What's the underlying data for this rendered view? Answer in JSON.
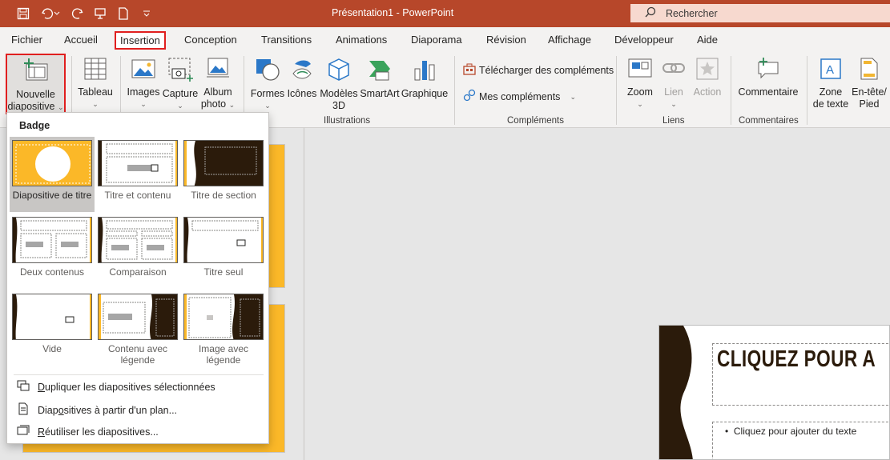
{
  "titlebar": {
    "title": "Présentation1  -  PowerPoint",
    "search_placeholder": "Rechercher"
  },
  "tabs": [
    "Fichier",
    "Accueil",
    "Insertion",
    "Conception",
    "Transitions",
    "Animations",
    "Diaporama",
    "Révision",
    "Affichage",
    "Développeur",
    "Aide"
  ],
  "ribbon": {
    "new_slide": [
      "Nouvelle",
      "diapositive"
    ],
    "table": "Tableau",
    "images": "Images",
    "capture": "Capture",
    "album": [
      "Album",
      "photo"
    ],
    "shapes": "Formes",
    "icons": "Icônes",
    "models3d": [
      "Modèles",
      "3D"
    ],
    "smartart": "SmartArt",
    "chart": "Graphique",
    "get_addins": "Télécharger des compléments",
    "my_addins": "Mes compléments",
    "zoom": "Zoom",
    "link": "Lien",
    "action": "Action",
    "comment": "Commentaire",
    "textbox": [
      "Zone",
      "de texte"
    ],
    "header": [
      "En-tête/",
      "Pied"
    ],
    "groups": {
      "illustrations": "Illustrations",
      "addins": "Compléments",
      "links": "Liens",
      "comments": "Commentaires"
    }
  },
  "dropdown": {
    "header": "Badge",
    "layouts": [
      {
        "label": "Diapositive de titre"
      },
      {
        "label": "Titre et contenu"
      },
      {
        "label": "Titre de section"
      },
      {
        "label": "Deux contenus"
      },
      {
        "label": "Comparaison"
      },
      {
        "label": "Titre seul"
      },
      {
        "label": "Vide"
      },
      {
        "label": "Contenu avec légende"
      },
      {
        "label": "Image avec légende"
      }
    ],
    "menu": [
      {
        "u": "D",
        "rest": "upliquer les diapositives sélectionnées"
      },
      {
        "pre": "Diap",
        "u": "o",
        "rest": "sitives à partir d'un plan..."
      },
      {
        "u": "R",
        "rest": "éutiliser les diapositives..."
      }
    ]
  },
  "slide": {
    "title": "CLIQUEZ POUR A",
    "body": "Cliquez pour ajouter du texte"
  },
  "colors": {
    "brand": "#b7472a",
    "accent_yellow": "#fbb828",
    "dark_brown": "#2b1b0b",
    "highlight_red": "#e01f1f"
  }
}
